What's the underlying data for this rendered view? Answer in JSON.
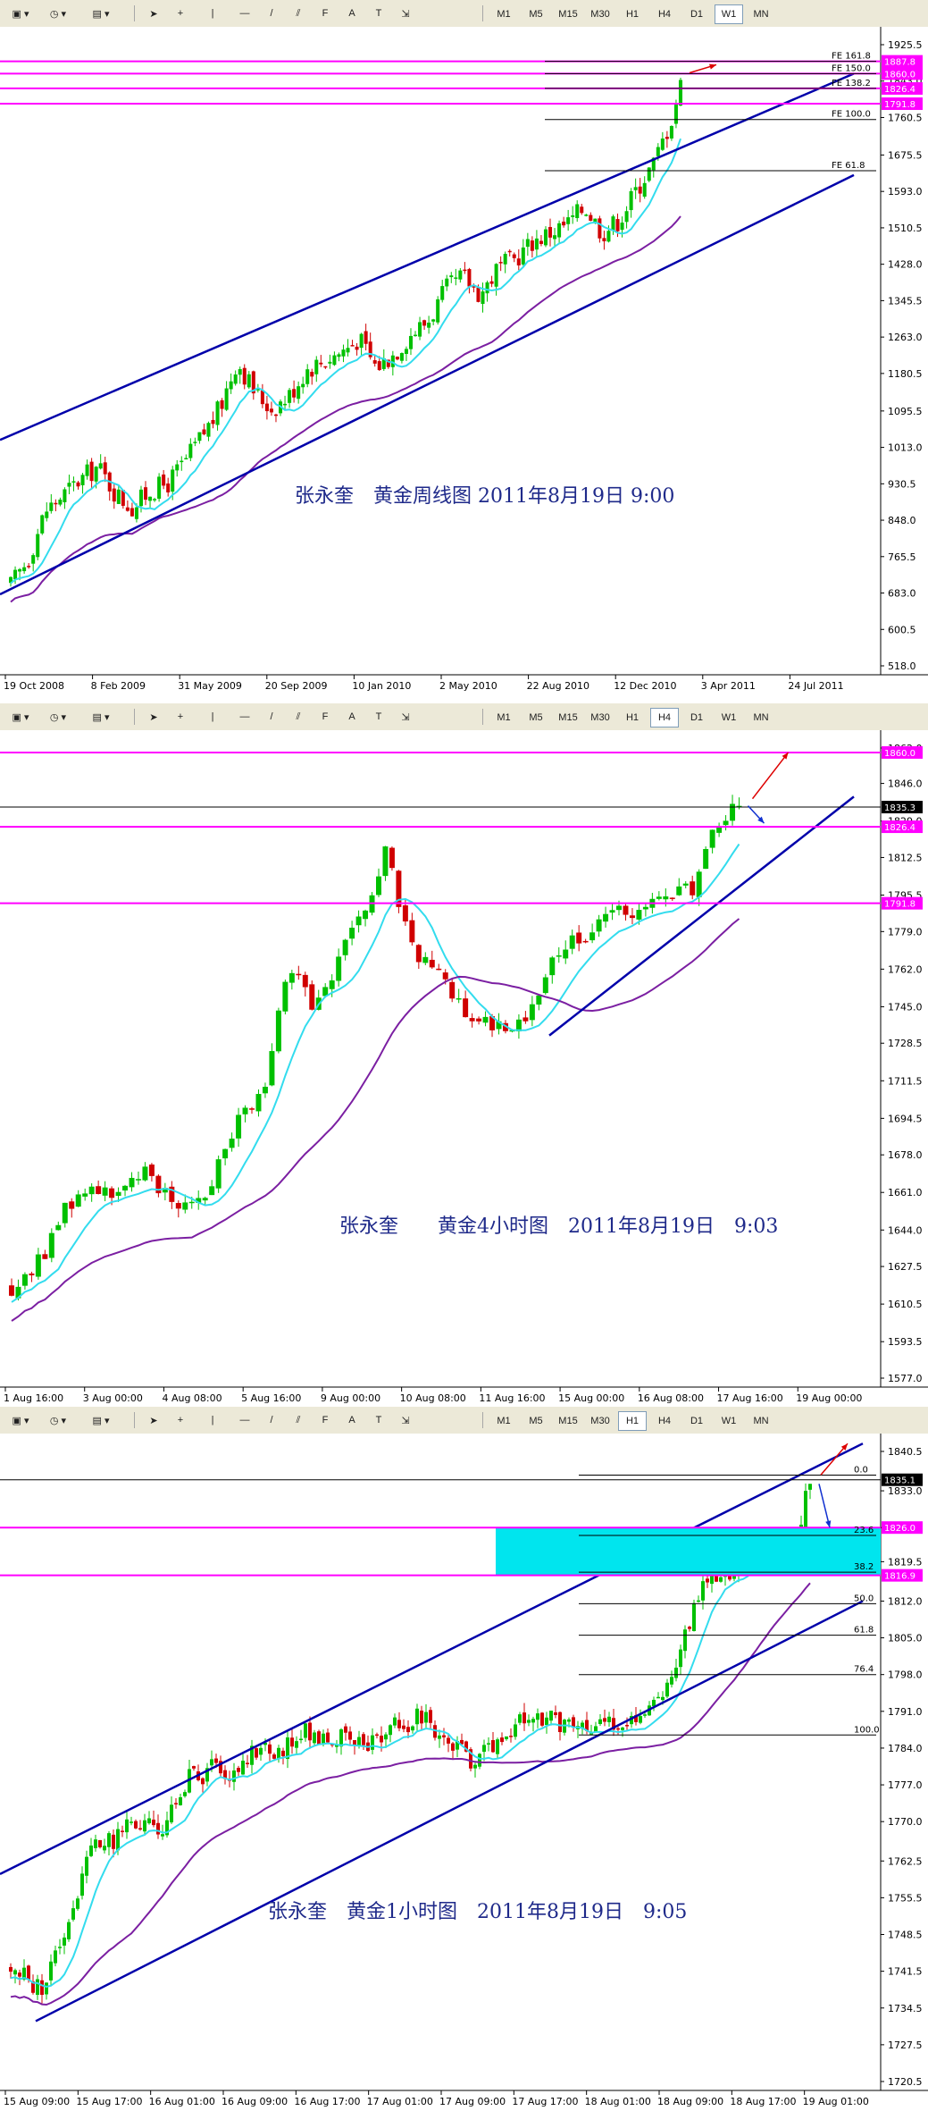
{
  "toolbar": {
    "timeframes": [
      "M1",
      "M5",
      "M15",
      "M30",
      "H1",
      "H4",
      "D1",
      "W1",
      "MN"
    ],
    "active": [
      "W1",
      "H4",
      "H1"
    ],
    "tool_glyphs": [
      "arrow-icon",
      "crosshair-icon",
      "vertical-line-icon",
      "horizontal-line-icon",
      "trendline-icon",
      "equidistant-channel-icon",
      "fibonacci-icon",
      "text-icon",
      "label-icon",
      "arrow-dropdown-icon"
    ]
  },
  "colors": {
    "candle_up": "#00c000",
    "candle_down": "#d00000",
    "ma_fast": "#33dcee",
    "ma_slow": "#7b1fa2",
    "channel": "#0000aa",
    "level": "#ff00ff",
    "price_line": "#000000",
    "zone": "#00e5ee"
  },
  "chart_data": [
    {
      "type": "candlestick",
      "title": "张永奎　黄金周线图  2011年8月19日  9:00",
      "timeframe": "W1",
      "y_ticks": [
        "1925.5",
        "1843.0",
        "1760.5",
        "1675.5",
        "1593.0",
        "1510.5",
        "1428.0",
        "1345.5",
        "1263.0",
        "1180.5",
        "1095.5",
        "1013.0",
        "930.5",
        "848.0",
        "765.5",
        "683.0",
        "600.5",
        "518.0"
      ],
      "ylim": [
        518.0,
        1925.5
      ],
      "x_labels": [
        "19 Oct 2008",
        "8 Feb 2009",
        "31 May 2009",
        "20 Sep 2009",
        "10 Jan 2010",
        "2 May 2010",
        "22 Aug 2010",
        "12 Dec 2010",
        "3 Apr 2011",
        "24 Jul 2011"
      ],
      "price_tags": [
        "1887.8",
        "1860.0",
        "1826.4",
        "1791.8"
      ],
      "fib_labels": [
        "FE 161.8",
        "FE 150.0",
        "FE 138.2",
        "FE 100.0",
        "FE 61.8"
      ],
      "fib_values": [
        1887.8,
        1860.0,
        1826.4,
        1756.0,
        1640.0
      ],
      "close_path": [
        [
          0,
          700
        ],
        [
          2,
          760
        ],
        [
          4,
          870
        ],
        [
          6,
          905
        ],
        [
          8,
          940
        ],
        [
          10,
          970
        ],
        [
          12,
          910
        ],
        [
          14,
          875
        ],
        [
          16,
          915
        ],
        [
          18,
          930
        ],
        [
          20,
          980
        ],
        [
          22,
          1040
        ],
        [
          24,
          1100
        ],
        [
          26,
          1210
        ],
        [
          28,
          1140
        ],
        [
          30,
          1100
        ],
        [
          32,
          1130
        ],
        [
          34,
          1190
        ],
        [
          36,
          1210
        ],
        [
          38,
          1230
        ],
        [
          40,
          1260
        ],
        [
          42,
          1195
        ],
        [
          44,
          1225
        ],
        [
          46,
          1270
        ],
        [
          48,
          1300
        ],
        [
          50,
          1370
        ],
        [
          52,
          1400
        ],
        [
          54,
          1360
        ],
        [
          56,
          1420
        ],
        [
          58,
          1440
        ],
        [
          60,
          1480
        ],
        [
          62,
          1500
        ],
        [
          64,
          1520
        ],
        [
          66,
          1560
        ],
        [
          68,
          1500
        ],
        [
          70,
          1530
        ],
        [
          72,
          1600
        ],
        [
          74,
          1660
        ],
        [
          76,
          1760
        ],
        [
          77,
          1835
        ]
      ]
    },
    {
      "type": "candlestick",
      "title": "张永奎　　黄金4小时图　2011年8月19日　9:03",
      "timeframe": "H4",
      "y_ticks": [
        "1862.0",
        "1846.0",
        "1829.0",
        "1812.5",
        "1795.5",
        "1779.0",
        "1762.0",
        "1745.0",
        "1728.5",
        "1711.5",
        "1694.5",
        "1678.0",
        "1661.0",
        "1644.0",
        "1627.5",
        "1610.5",
        "1593.5",
        "1577.0"
      ],
      "ylim": [
        1577.0,
        1862.0
      ],
      "x_labels": [
        "1 Aug 16:00",
        "3 Aug 00:00",
        "4 Aug 08:00",
        "5 Aug 16:00",
        "9 Aug 00:00",
        "10 Aug 08:00",
        "11 Aug 16:00",
        "15 Aug 00:00",
        "16 Aug 08:00",
        "17 Aug 16:00",
        "19 Aug 00:00"
      ],
      "price_tags": [
        "1860.0",
        "1835.3",
        "1826.4",
        "1791.8"
      ],
      "close_path": [
        [
          0,
          1618
        ],
        [
          4,
          1630
        ],
        [
          8,
          1655
        ],
        [
          12,
          1665
        ],
        [
          16,
          1660
        ],
        [
          20,
          1670
        ],
        [
          24,
          1655
        ],
        [
          28,
          1662
        ],
        [
          32,
          1690
        ],
        [
          36,
          1705
        ],
        [
          40,
          1760
        ],
        [
          44,
          1745
        ],
        [
          48,
          1770
        ],
        [
          52,
          1795
        ],
        [
          54,
          1815
        ],
        [
          56,
          1790
        ],
        [
          58,
          1770
        ],
        [
          62,
          1758
        ],
        [
          66,
          1742
        ],
        [
          70,
          1735
        ],
        [
          74,
          1740
        ],
        [
          78,
          1765
        ],
        [
          82,
          1778
        ],
        [
          86,
          1785
        ],
        [
          90,
          1790
        ],
        [
          94,
          1792
        ],
        [
          98,
          1798
        ],
        [
          100,
          1815
        ],
        [
          103,
          1830
        ],
        [
          105,
          1835
        ]
      ]
    },
    {
      "type": "candlestick",
      "title": "张永奎　黄金1小时图　2011年8月19日　9:05",
      "timeframe": "H1",
      "y_ticks": [
        "1840.5",
        "1833.0",
        "1826.0",
        "1819.5",
        "1812.0",
        "1805.0",
        "1798.0",
        "1791.0",
        "1784.0",
        "1777.0",
        "1770.0",
        "1762.5",
        "1755.5",
        "1748.5",
        "1741.5",
        "1734.5",
        "1727.5",
        "1720.5"
      ],
      "ylim": [
        1720.5,
        1840.5
      ],
      "x_labels": [
        "15 Aug 09:00",
        "15 Aug 17:00",
        "16 Aug 01:00",
        "16 Aug 09:00",
        "16 Aug 17:00",
        "17 Aug 01:00",
        "17 Aug 09:00",
        "17 Aug 17:00",
        "18 Aug 01:00",
        "18 Aug 09:00",
        "18 Aug 17:00",
        "19 Aug 01:00"
      ],
      "price_tags": [
        "1835.1",
        "1826.0",
        "1816.9"
      ],
      "fib_labels": [
        "0.0",
        "23.6",
        "38.2",
        "50.0",
        "61.8",
        "76.4",
        "100.0"
      ],
      "fib_values": [
        1836.0,
        1824.5,
        1817.5,
        1811.5,
        1805.5,
        1798.0,
        1786.5
      ],
      "close_path": [
        [
          0,
          1742
        ],
        [
          4,
          1738
        ],
        [
          6,
          1744
        ],
        [
          8,
          1752
        ],
        [
          10,
          1762
        ],
        [
          12,
          1767
        ],
        [
          14,
          1766
        ],
        [
          16,
          1770
        ],
        [
          18,
          1769
        ],
        [
          20,
          1768
        ],
        [
          22,
          1772
        ],
        [
          24,
          1779
        ],
        [
          26,
          1777
        ],
        [
          28,
          1782
        ],
        [
          30,
          1778
        ],
        [
          32,
          1783
        ],
        [
          34,
          1785
        ],
        [
          36,
          1782
        ],
        [
          38,
          1786
        ],
        [
          40,
          1787
        ],
        [
          44,
          1786
        ],
        [
          48,
          1784
        ],
        [
          52,
          1788
        ],
        [
          56,
          1790
        ],
        [
          58,
          1786
        ],
        [
          60,
          1784
        ],
        [
          62,
          1782
        ],
        [
          66,
          1786
        ],
        [
          70,
          1790
        ],
        [
          74,
          1789
        ],
        [
          78,
          1787
        ],
        [
          82,
          1789
        ],
        [
          86,
          1791
        ],
        [
          88,
          1795
        ],
        [
          90,
          1800
        ],
        [
          92,
          1810
        ],
        [
          94,
          1816
        ],
        [
          96,
          1817
        ],
        [
          98,
          1818
        ],
        [
          100,
          1820
        ],
        [
          102,
          1822
        ],
        [
          104,
          1823
        ],
        [
          106,
          1824
        ],
        [
          108,
          1835
        ]
      ]
    }
  ]
}
